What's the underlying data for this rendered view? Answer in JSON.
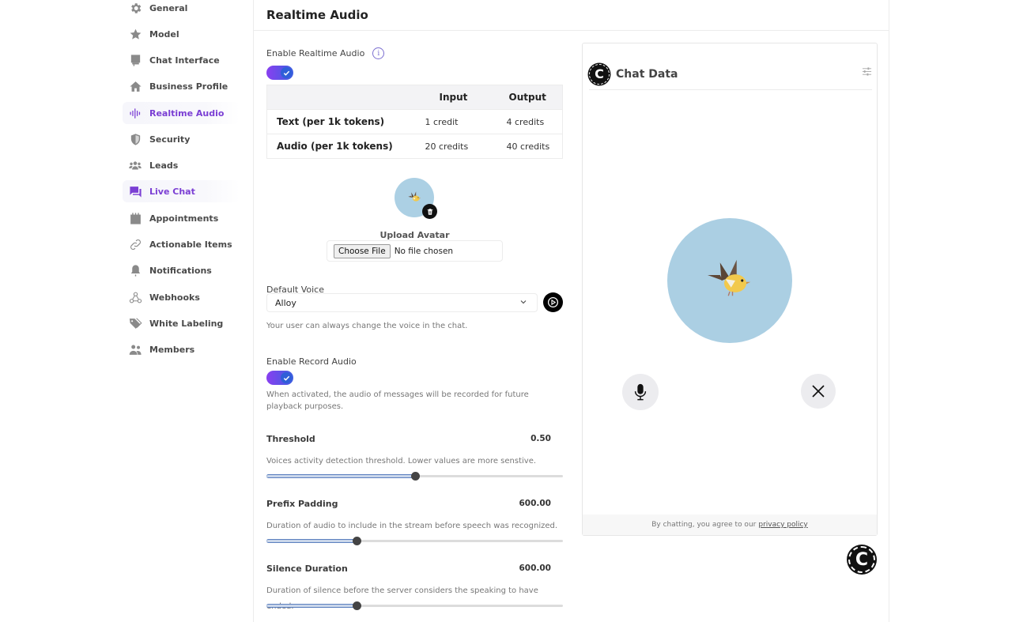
{
  "sidebar": {
    "items": [
      {
        "label": "General",
        "icon": "gear-icon"
      },
      {
        "label": "Model",
        "icon": "star-icon"
      },
      {
        "label": "Chat Interface",
        "icon": "monitor-icon"
      },
      {
        "label": "Business Profile",
        "icon": "home-icon"
      },
      {
        "label": "Realtime Audio",
        "icon": "audio-wave-icon",
        "active": true
      },
      {
        "label": "Security",
        "icon": "shield-icon"
      },
      {
        "label": "Leads",
        "icon": "users-icon"
      },
      {
        "label": "Live Chat",
        "icon": "chat-icon",
        "highlight": true
      },
      {
        "label": "Appointments",
        "icon": "calendar-icon"
      },
      {
        "label": "Actionable Items",
        "icon": "link-icon"
      },
      {
        "label": "Notifications",
        "icon": "bell-icon"
      },
      {
        "label": "Webhooks",
        "icon": "webhook-icon"
      },
      {
        "label": "White Labeling",
        "icon": "tag-icon"
      },
      {
        "label": "Members",
        "icon": "members-icon"
      }
    ]
  },
  "main": {
    "title": "Realtime Audio",
    "enable_realtime": {
      "label": "Enable Realtime Audio",
      "enabled": true
    },
    "pricing": {
      "headers": [
        "",
        "Input",
        "Output"
      ],
      "rows": [
        {
          "name": "Text (per 1k tokens)",
          "input": "1 credit",
          "output": "4 credits"
        },
        {
          "name": "Audio (per 1k tokens)",
          "input": "20 credits",
          "output": "40 credits"
        }
      ]
    },
    "avatar": {
      "upload_label": "Upload Avatar",
      "choose_file": "Choose File",
      "file_status": "No file chosen"
    },
    "default_voice": {
      "label": "Default Voice",
      "value": "Alloy",
      "help": "Your user can always change the voice in the chat."
    },
    "record_audio": {
      "label": "Enable Record Audio",
      "enabled": true,
      "help": "When activated, the audio of messages will be recorded for future playback purposes."
    },
    "threshold": {
      "label": "Threshold",
      "value": "0.50",
      "fraction": 0.5,
      "help": "Voices activity detection threshold. Lower values are more senstive."
    },
    "prefix_padding": {
      "label": "Prefix Padding",
      "value": "600.00",
      "fraction": 0.305,
      "help": "Duration of audio to include in the stream before speech was recognized."
    },
    "silence_duration": {
      "label": "Silence Duration",
      "value": "600.00",
      "fraction": 0.305,
      "help": "Duration of silence before the server considers the speaking to have ended."
    }
  },
  "chat_preview": {
    "title": "Chat Data",
    "logo_letter": "C",
    "footer_text": "By chatting, you agree to our",
    "footer_link": "privacy policy"
  },
  "colors": {
    "accent": "#7b3fd4",
    "toggle_start": "#8a3ff0",
    "toggle_end": "#3b5fe0",
    "avatar_bg": "#abcfe3"
  }
}
